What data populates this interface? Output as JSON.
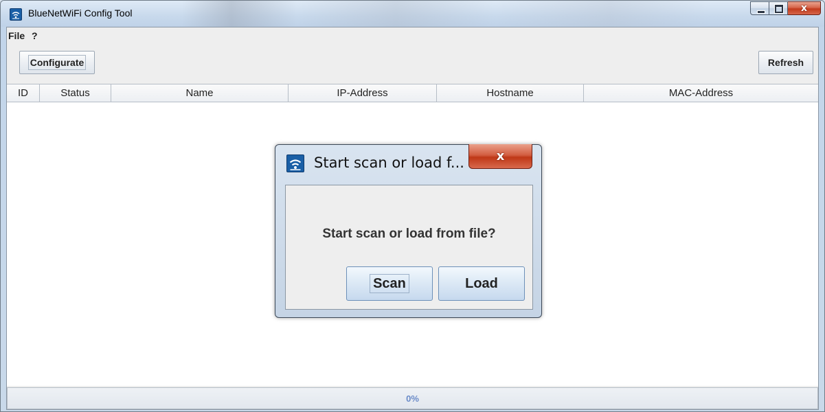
{
  "window": {
    "title": "BlueNetWiFi Config Tool",
    "icon": "wifi-icon"
  },
  "caption": {
    "close_glyph": "x"
  },
  "menu": {
    "items": [
      {
        "label": "File"
      },
      {
        "label": "?"
      }
    ]
  },
  "toolbar": {
    "configurate_label": "Configurate",
    "refresh_label": "Refresh"
  },
  "table": {
    "columns": [
      {
        "label": "ID"
      },
      {
        "label": "Status"
      },
      {
        "label": "Name"
      },
      {
        "label": "IP-Address"
      },
      {
        "label": "Hostname"
      },
      {
        "label": "MAC-Address"
      }
    ],
    "rows": []
  },
  "status": {
    "progress_text": "0%",
    "progress_value": 0
  },
  "dialog": {
    "title": "Start scan or load f...",
    "icon": "wifi-icon",
    "close_glyph": "x",
    "message": "Start scan or load from file?",
    "scan_label": "Scan",
    "load_label": "Load"
  },
  "colors": {
    "accent": "#1a5fa6",
    "close_red": "#c23b1c",
    "progress_text": "#6a8bc8"
  }
}
